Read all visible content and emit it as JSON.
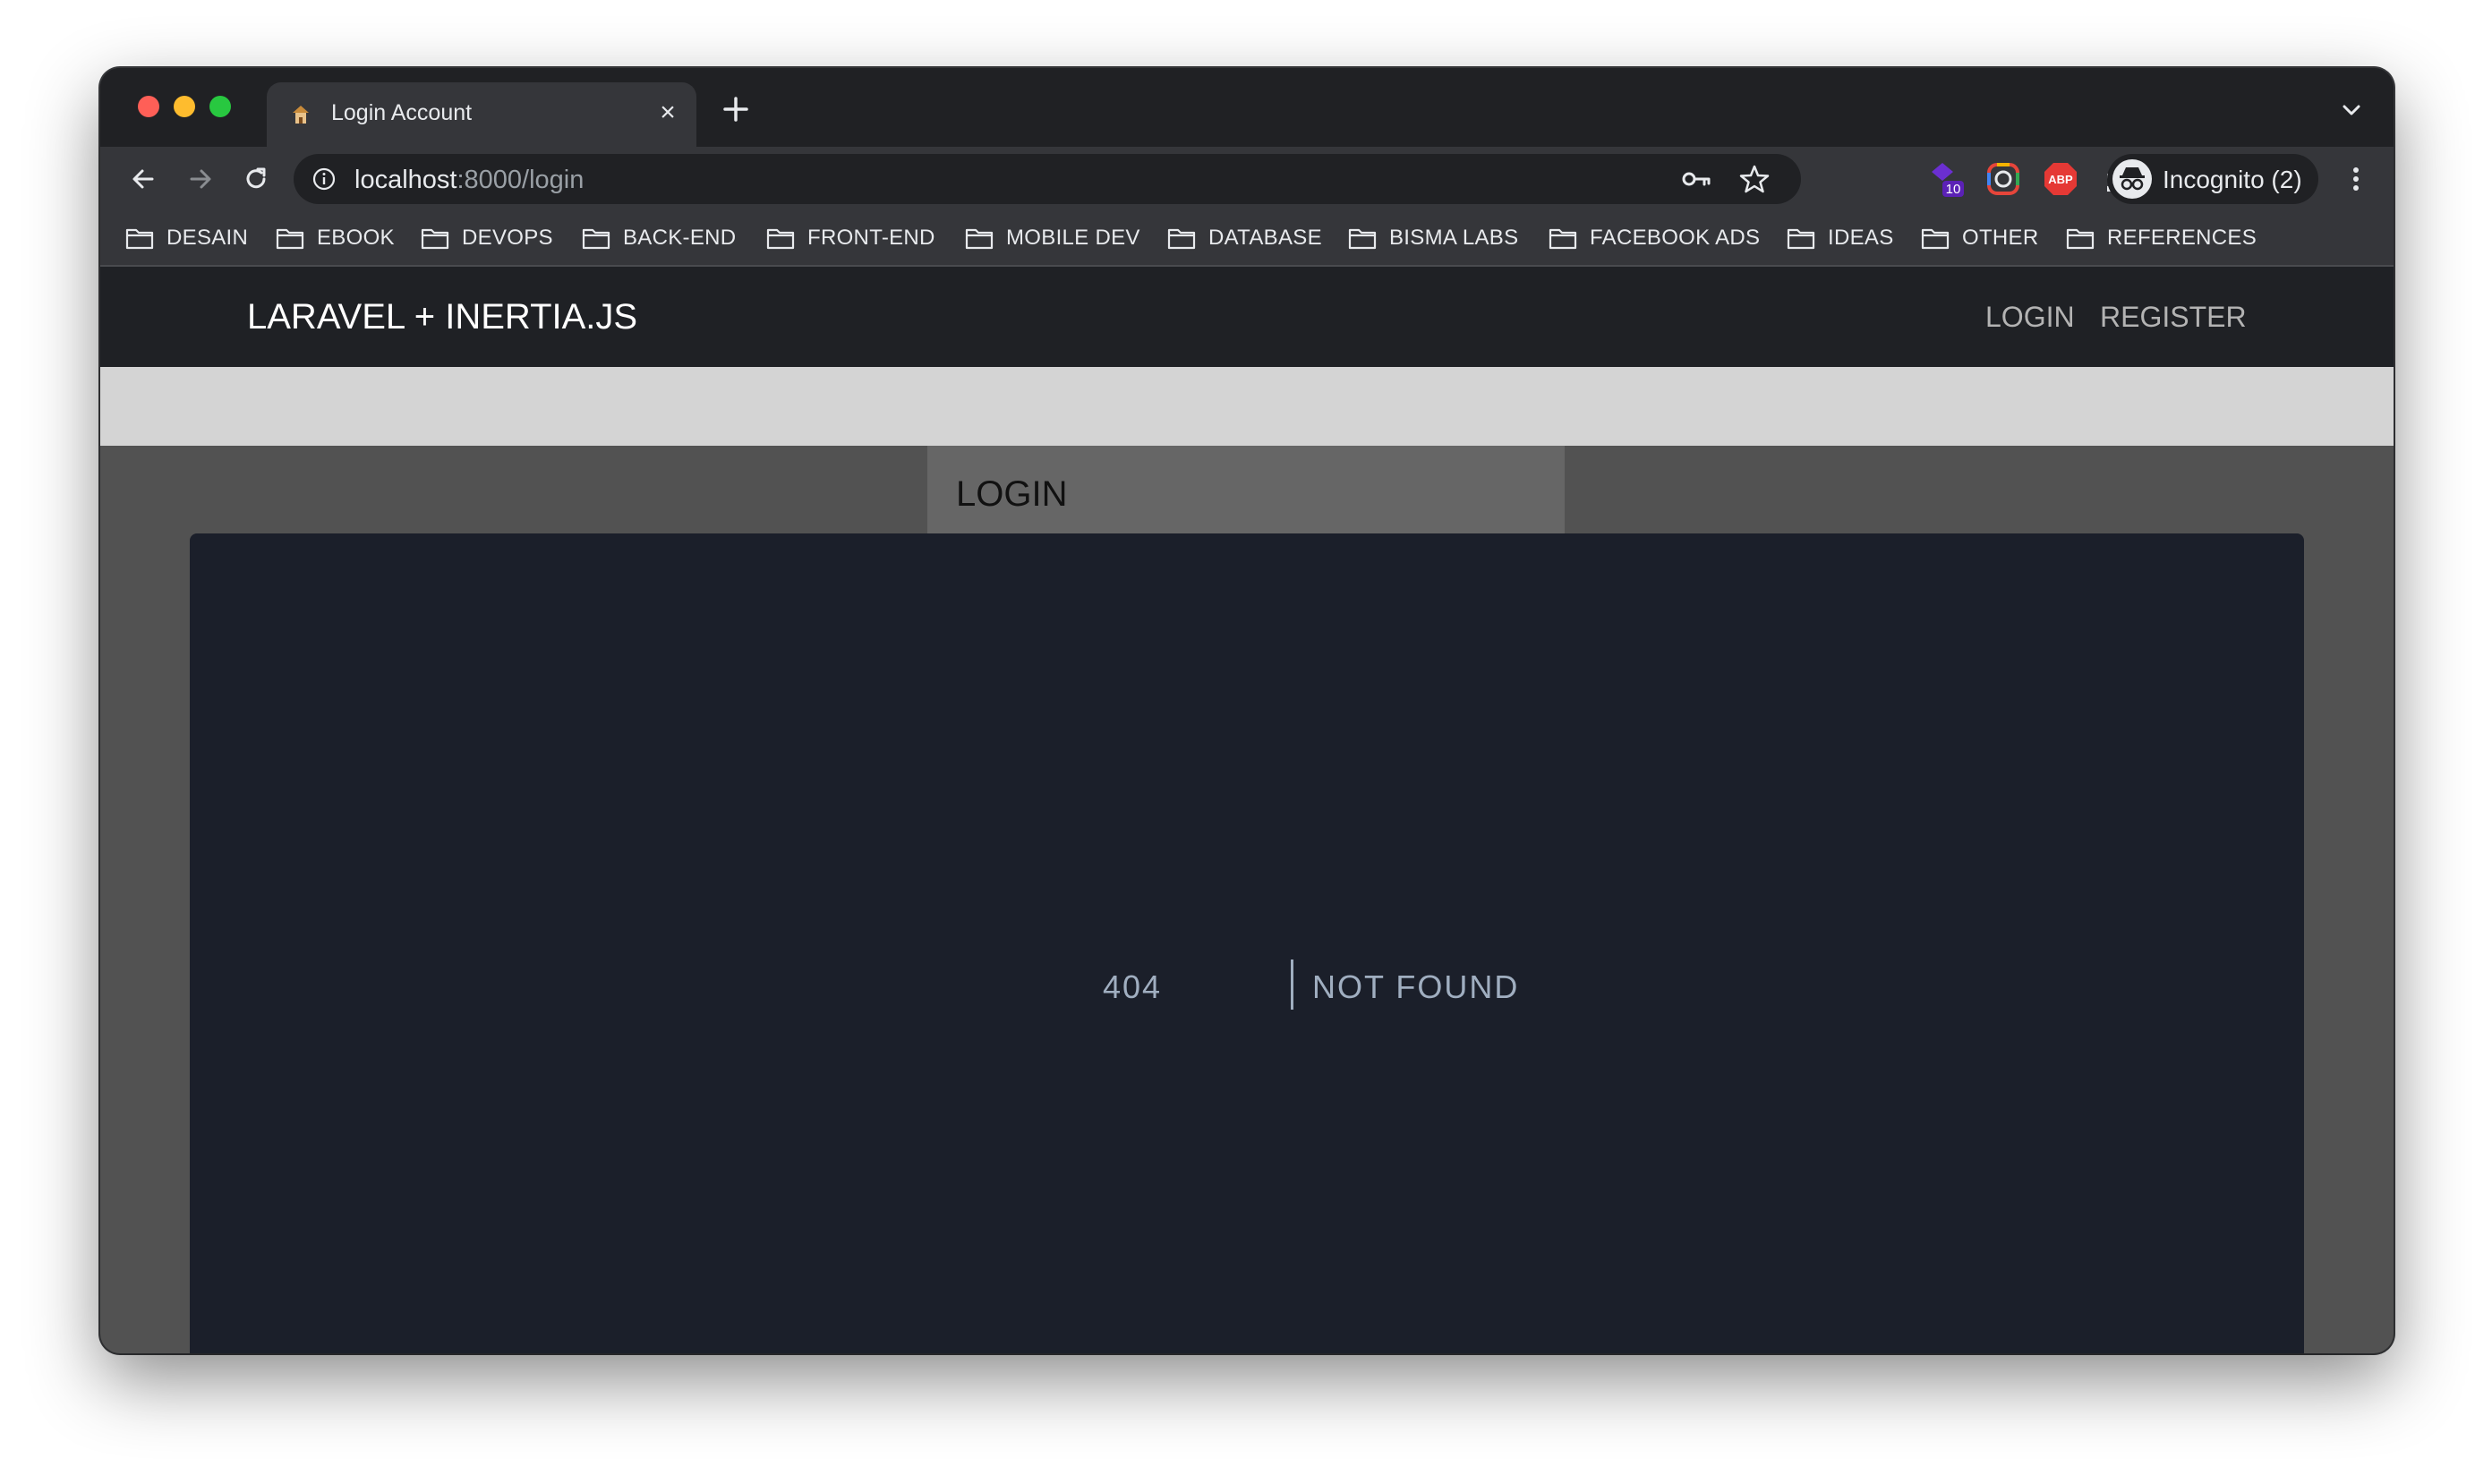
{
  "browser": {
    "tab": {
      "title": "Login Account",
      "close_glyph": "×"
    },
    "address_bar": {
      "host": "localhost",
      "rest": ":8000/login"
    },
    "profile": {
      "label": "Incognito (2)"
    },
    "extensions": {
      "badge_count": "10",
      "adblock_label": "ABP"
    },
    "bookmarks": [
      {
        "label": "DESAIN"
      },
      {
        "label": "EBOOK"
      },
      {
        "label": "DEVOPS"
      },
      {
        "label": "BACK-END"
      },
      {
        "label": "FRONT-END"
      },
      {
        "label": "MOBILE DEV"
      },
      {
        "label": "DATABASE"
      },
      {
        "label": "BISMA LABS"
      },
      {
        "label": "FACEBOOK ADS"
      },
      {
        "label": "IDEAS"
      },
      {
        "label": "OTHER"
      },
      {
        "label": "REFERENCES"
      }
    ]
  },
  "app": {
    "brand": "LARAVEL + INERTIA.JS",
    "nav": {
      "login": "LOGIN",
      "register": "REGISTER"
    },
    "card": {
      "title": "LOGIN"
    },
    "error": {
      "code": "404",
      "message": "NOT FOUND"
    }
  },
  "colors": {
    "window_chrome": "#202124",
    "toolbar": "#35363a",
    "app_nav": "#1f2125",
    "band": "#d4d4d4",
    "page_bg": "#525252",
    "card_header": "#666666",
    "error_bg": "#1b1f2a",
    "error_text": "#a0aec0"
  }
}
